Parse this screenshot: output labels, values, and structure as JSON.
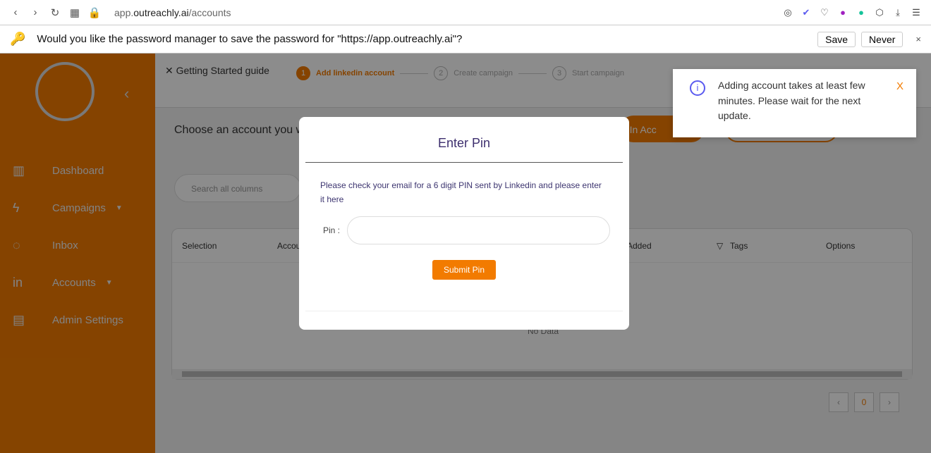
{
  "browser": {
    "url_host": "app.",
    "url_domain": "outreachly.ai",
    "url_path": "/accounts"
  },
  "password_bar": {
    "message": "Would you like the password manager to save the password for \"https://app.outreachly.ai\"?",
    "save": "Save",
    "never": "Never",
    "close": "×"
  },
  "sidebar": {
    "items": [
      {
        "label": "Dashboard",
        "icon": "chart-icon"
      },
      {
        "label": "Campaigns",
        "icon": "bolt-icon",
        "dropdown": true
      },
      {
        "label": "Inbox",
        "icon": "chat-icon"
      },
      {
        "label": "Accounts",
        "icon": "linkedin-icon",
        "dropdown": true
      },
      {
        "label": "Admin Settings",
        "icon": "admin-icon"
      }
    ]
  },
  "guide": {
    "title": "Getting Started guide",
    "steps": [
      {
        "n": "1",
        "label": "Add linkedin account"
      },
      {
        "n": "2",
        "label": "Create campaign"
      },
      {
        "n": "3",
        "label": "Start campaign"
      }
    ]
  },
  "page": {
    "choose": "Choose an account you w",
    "add_button": "kedIn Acc",
    "search_placeholder": "Search all columns",
    "no_data": "No Data",
    "page_number": "0"
  },
  "table": {
    "columns": [
      "Selection",
      "Accou",
      "Added",
      "Tags",
      "Options"
    ]
  },
  "modal": {
    "title": "Enter Pin",
    "description": "Please check your email for a 6 digit PIN sent by Linkedin and please enter it here",
    "pin_label": "Pin :",
    "submit": "Submit Pin"
  },
  "toast": {
    "message": "Adding account takes at least few minutes. Please wait for the next update.",
    "close": "X"
  },
  "colors": {
    "accent": "#f27b00",
    "modal_text": "#3d2f6e",
    "info": "#5b5bf0"
  }
}
